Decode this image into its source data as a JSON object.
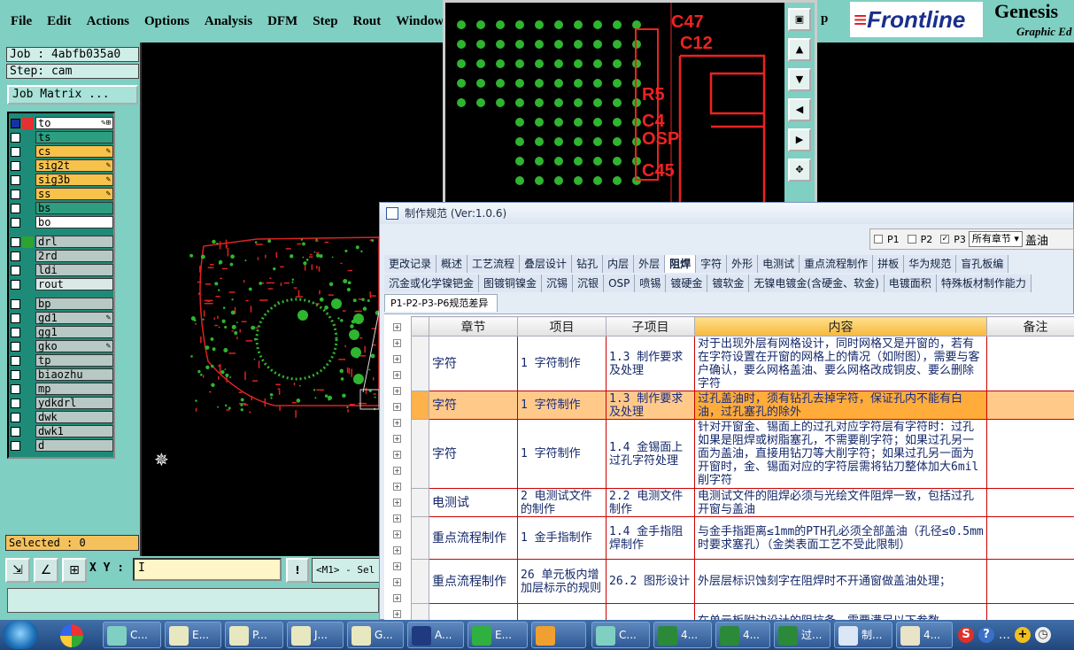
{
  "menubar": {
    "items": [
      "File",
      "Edit",
      "Actions",
      "Options",
      "Analysis",
      "DFM",
      "Step",
      "Rout",
      "Windows"
    ],
    "overflow_fragment": "p"
  },
  "brand": {
    "logo_text_red": "≡",
    "logo_text": "Frontline",
    "product": "Genesis",
    "tagline": "Graphic Ed"
  },
  "job": {
    "job_label": "Job : 4abfb035a0",
    "step_label": "Step: cam",
    "matrix_button": "Job Matrix ..."
  },
  "layers": [
    {
      "name": "to",
      "color": "#ffffff",
      "swatch": "#e53030",
      "pens": "✎⊞",
      "active": true
    },
    {
      "name": "ts",
      "color": "#2e9e80",
      "swatch": "",
      "pens": ""
    },
    {
      "name": "cs",
      "color": "#f7c24a",
      "swatch": "",
      "pens": "✎"
    },
    {
      "name": "sig2t",
      "color": "#f7c24a",
      "swatch": "",
      "pens": "✎"
    },
    {
      "name": "sig3b",
      "color": "#f7c24a",
      "swatch": "",
      "pens": "✎"
    },
    {
      "name": "ss",
      "color": "#f7c24a",
      "swatch": "",
      "pens": "✎"
    },
    {
      "name": "bs",
      "color": "#2e9e80",
      "swatch": "",
      "pens": ""
    },
    {
      "name": "bo",
      "color": "#ffffff",
      "swatch": "",
      "pens": ""
    },
    {
      "name": "drl",
      "color": "#b8c8c4",
      "swatch": "#2fa32f",
      "pens": ""
    },
    {
      "name": "2rd",
      "color": "#b8c8c4",
      "swatch": "",
      "pens": ""
    },
    {
      "name": "ldi",
      "color": "#b8c8c4",
      "swatch": "",
      "pens": ""
    },
    {
      "name": "rout",
      "color": "#dce8e6",
      "swatch": "",
      "pens": ""
    },
    {
      "name": "bp",
      "color": "#b8c8c4",
      "swatch": "",
      "pens": ""
    },
    {
      "name": "gd1",
      "color": "#b8c8c4",
      "swatch": "",
      "pens": "✎"
    },
    {
      "name": "gg1",
      "color": "#b8c8c4",
      "swatch": "",
      "pens": ""
    },
    {
      "name": "gko",
      "color": "#b8c8c4",
      "swatch": "",
      "pens": "✎"
    },
    {
      "name": "tp",
      "color": "#b8c8c4",
      "swatch": "",
      "pens": ""
    },
    {
      "name": "biaozhu",
      "color": "#b8c8c4",
      "swatch": "",
      "pens": ""
    },
    {
      "name": "mp",
      "color": "#b8c8c4",
      "swatch": "",
      "pens": ""
    },
    {
      "name": "ydkdrl",
      "color": "#b8c8c4",
      "swatch": "",
      "pens": ""
    },
    {
      "name": "dwk",
      "color": "#b8c8c4",
      "swatch": "",
      "pens": ""
    },
    {
      "name": "dwk1",
      "color": "#b8c8c4",
      "swatch": "",
      "pens": ""
    },
    {
      "name": "d",
      "color": "#b8c8c4",
      "swatch": "",
      "pens": ""
    }
  ],
  "status": {
    "selected": "Selected : 0",
    "xy_label": "X Y :",
    "xy_value": "I",
    "excl": "!",
    "mouse_msg": "<M1> - Sel"
  },
  "zoom": {
    "labels": [
      "C47",
      "C12",
      "R5",
      "C4",
      "OSP",
      "C45"
    ]
  },
  "dialog": {
    "title": "制作规范 (Ver:1.0.6)",
    "filters": {
      "p1": "P1",
      "p2": "P2",
      "p3": "P3",
      "p3_checked": "✓",
      "chapter_select": "所有章节",
      "chapter_arrow": "▾",
      "extra": "盖油"
    },
    "tabs1": [
      "更改记录",
      "概述",
      "工艺流程",
      "叠层设计",
      "钻孔",
      "内层",
      "外层",
      "阻焊",
      "字符",
      "外形",
      "电测试",
      "重点流程制作",
      "拼板",
      "华为规范",
      "盲孔板编"
    ],
    "active_tab": "阻焊",
    "tabs2": [
      "沉金或化学镍钯金",
      "图镀铜镍金",
      "沉锡",
      "沉银",
      "OSP",
      "喷锡",
      "镀硬金",
      "镀软金",
      "无镍电镀金(含硬金、软金)",
      "电镀面积",
      "特殊板材制作能力"
    ],
    "subtab": "P1-P2-P3-P6规范差异",
    "columns": [
      "章节",
      "项目",
      "子项目",
      "内容",
      "备注"
    ],
    "rows": [
      {
        "chapter": "字符",
        "item": "1 字符制作",
        "sub": "1.3 制作要求及处理",
        "content": "对于出现外层有网格设计，同时网格又是开窗的，若有在字符设置在开窗的网格上的情况（如附图），需要与客户确认，要么网格盖油、要么网格改成铜皮、要么删除字符",
        "note": ""
      },
      {
        "chapter": "字符",
        "item": "1 字符制作",
        "sub": "1.3 制作要求及处理",
        "content": "过孔盖油时，须有钻孔去掉字符，保证孔内不能有白油，过孔塞孔的除外",
        "note": "",
        "selected": true
      },
      {
        "chapter": "字符",
        "item": "1 字符制作",
        "sub": "1.4 金锡面上过孔字符处理",
        "content": "针对开窗金、锡面上的过孔对应字符层有字符时：过孔如果是阻焊或树脂塞孔，不需要削字符；如果过孔另一面为盖油，直接用钻刀等大削字符；如果过孔另一面为开窗时，金、锡面对应的字符层需将钻刀整体加大6mil削字符",
        "note": ""
      },
      {
        "chapter": "电测试",
        "item": "2 电测试文件的制作",
        "sub": "2.2 电测文件制作",
        "content": "电测试文件的阻焊必须与光绘文件阻焊一致，包括过孔开窗与盖油",
        "note": ""
      },
      {
        "chapter": "重点流程制作",
        "item": "1 金手指制作",
        "sub": "1.4 金手指阻焊制作",
        "content": "与金手指距离≤1mm的PTH孔必须全部盖油（孔径≤0.5mm时要求塞孔）（金类表面工艺不受此限制）",
        "note": ""
      },
      {
        "chapter": "重点流程制作",
        "item": "26 单元板内增加层标示的规则",
        "sub": "26.2 图形设计",
        "content": "外层层标识蚀刻字在阻焊时不开通窗做盖油处理；",
        "note": ""
      },
      {
        "chapter": "",
        "item": "",
        "sub": "",
        "content": "在单元板附边设计的阻抗条，需要满足以下参数",
        "note": ""
      }
    ]
  },
  "taskbar": {
    "buttons": [
      {
        "label": "C...",
        "icon": "cam-icon",
        "bg": "#7fcfc2"
      },
      {
        "label": "E...",
        "icon": "x-icon",
        "bg": "#e8e8c0"
      },
      {
        "label": "P...",
        "icon": "x-icon",
        "bg": "#e8e8c0"
      },
      {
        "label": "J...",
        "icon": "x-icon",
        "bg": "#e8e8c0"
      },
      {
        "label": "G...",
        "icon": "x-icon",
        "bg": "#e8e8c0"
      },
      {
        "label": "A...",
        "icon": "floppy-icon",
        "bg": "#203a80"
      },
      {
        "label": "E...",
        "icon": "frontline-f-icon",
        "bg": "#2fb040"
      },
      {
        "label": "",
        "icon": "shell-icon",
        "bg": "#f0a030"
      },
      {
        "label": "C...",
        "icon": "cam-icon",
        "bg": "#7fcfc2"
      },
      {
        "label": "4...",
        "icon": "excel-icon",
        "bg": "#2a8a3a"
      },
      {
        "label": "4...",
        "icon": "excel-icon",
        "bg": "#2a8a3a"
      },
      {
        "label": "过...",
        "icon": "excel-icon",
        "bg": "#2a8a3a"
      },
      {
        "label": "制...",
        "icon": "list-icon",
        "bg": "#dbe6f6"
      },
      {
        "label": "4...",
        "icon": "word-icon",
        "bg": "#e9e3c8"
      }
    ],
    "tray": {
      "s_icon": "S",
      "help_icon": "?",
      "text": "…"
    }
  }
}
